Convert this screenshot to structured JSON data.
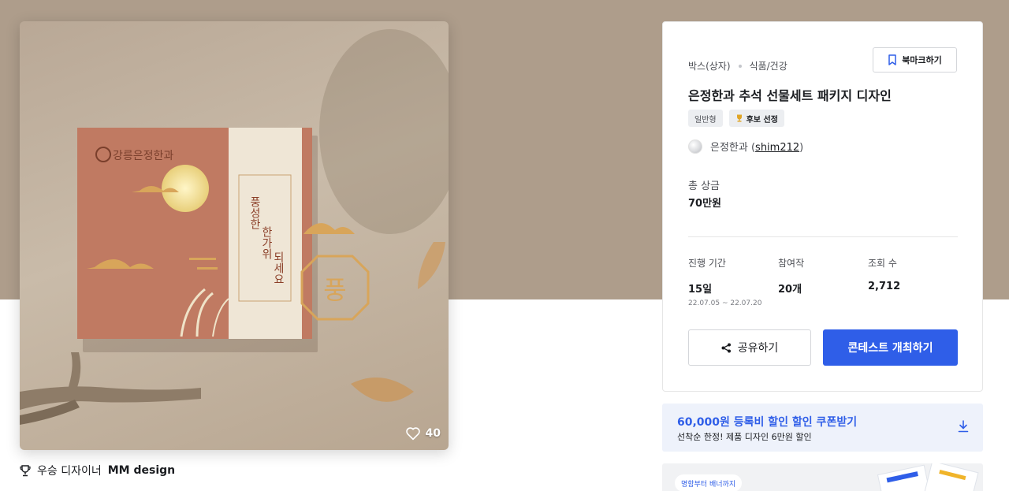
{
  "contest": {
    "categories": [
      "박스(상자)",
      "식품/건강"
    ],
    "bookmark_label": "북마크하기",
    "title": "은정한과 추석 선물세트 패키지 디자인",
    "tags": [
      "일반형",
      "후보 선정"
    ],
    "host_name": "은정한과 (",
    "host_id": "shim212",
    "host_close": ")",
    "prize_label": "총 상금",
    "prize_value": "70만원",
    "stats": [
      {
        "label": "진행 기간",
        "value": "15일",
        "sub": "22.07.05 ~ 22.07.20"
      },
      {
        "label": "참여작",
        "value": "20개"
      },
      {
        "label": "조회 수",
        "value": "2,712"
      }
    ],
    "share_label": "공유하기",
    "host_contest_label": "콘테스트 개최하기"
  },
  "image": {
    "like_count": "40",
    "package_text": {
      "brand": "강릉은정한과",
      "vertical_main_1": "풍성한",
      "vertical_main_2": "한가위",
      "vertical_main_3": "되세요",
      "emblem": "풍"
    }
  },
  "winner": {
    "prefix": "우승 디자이너",
    "name": "MM design"
  },
  "coupon": {
    "title": "60,000원 등록비 할인 할인 쿠폰받기",
    "subtitle": "선착순 한정! 제품 디자인 6만원 할인"
  },
  "promo": {
    "chip": "명함부터 배너까지"
  },
  "colors": {
    "hero_bg": "#ae9d8b",
    "accent": "#2f5ee8",
    "package": "#c07a62",
    "band": "#efe6d6",
    "gold": "#d2a85a"
  }
}
